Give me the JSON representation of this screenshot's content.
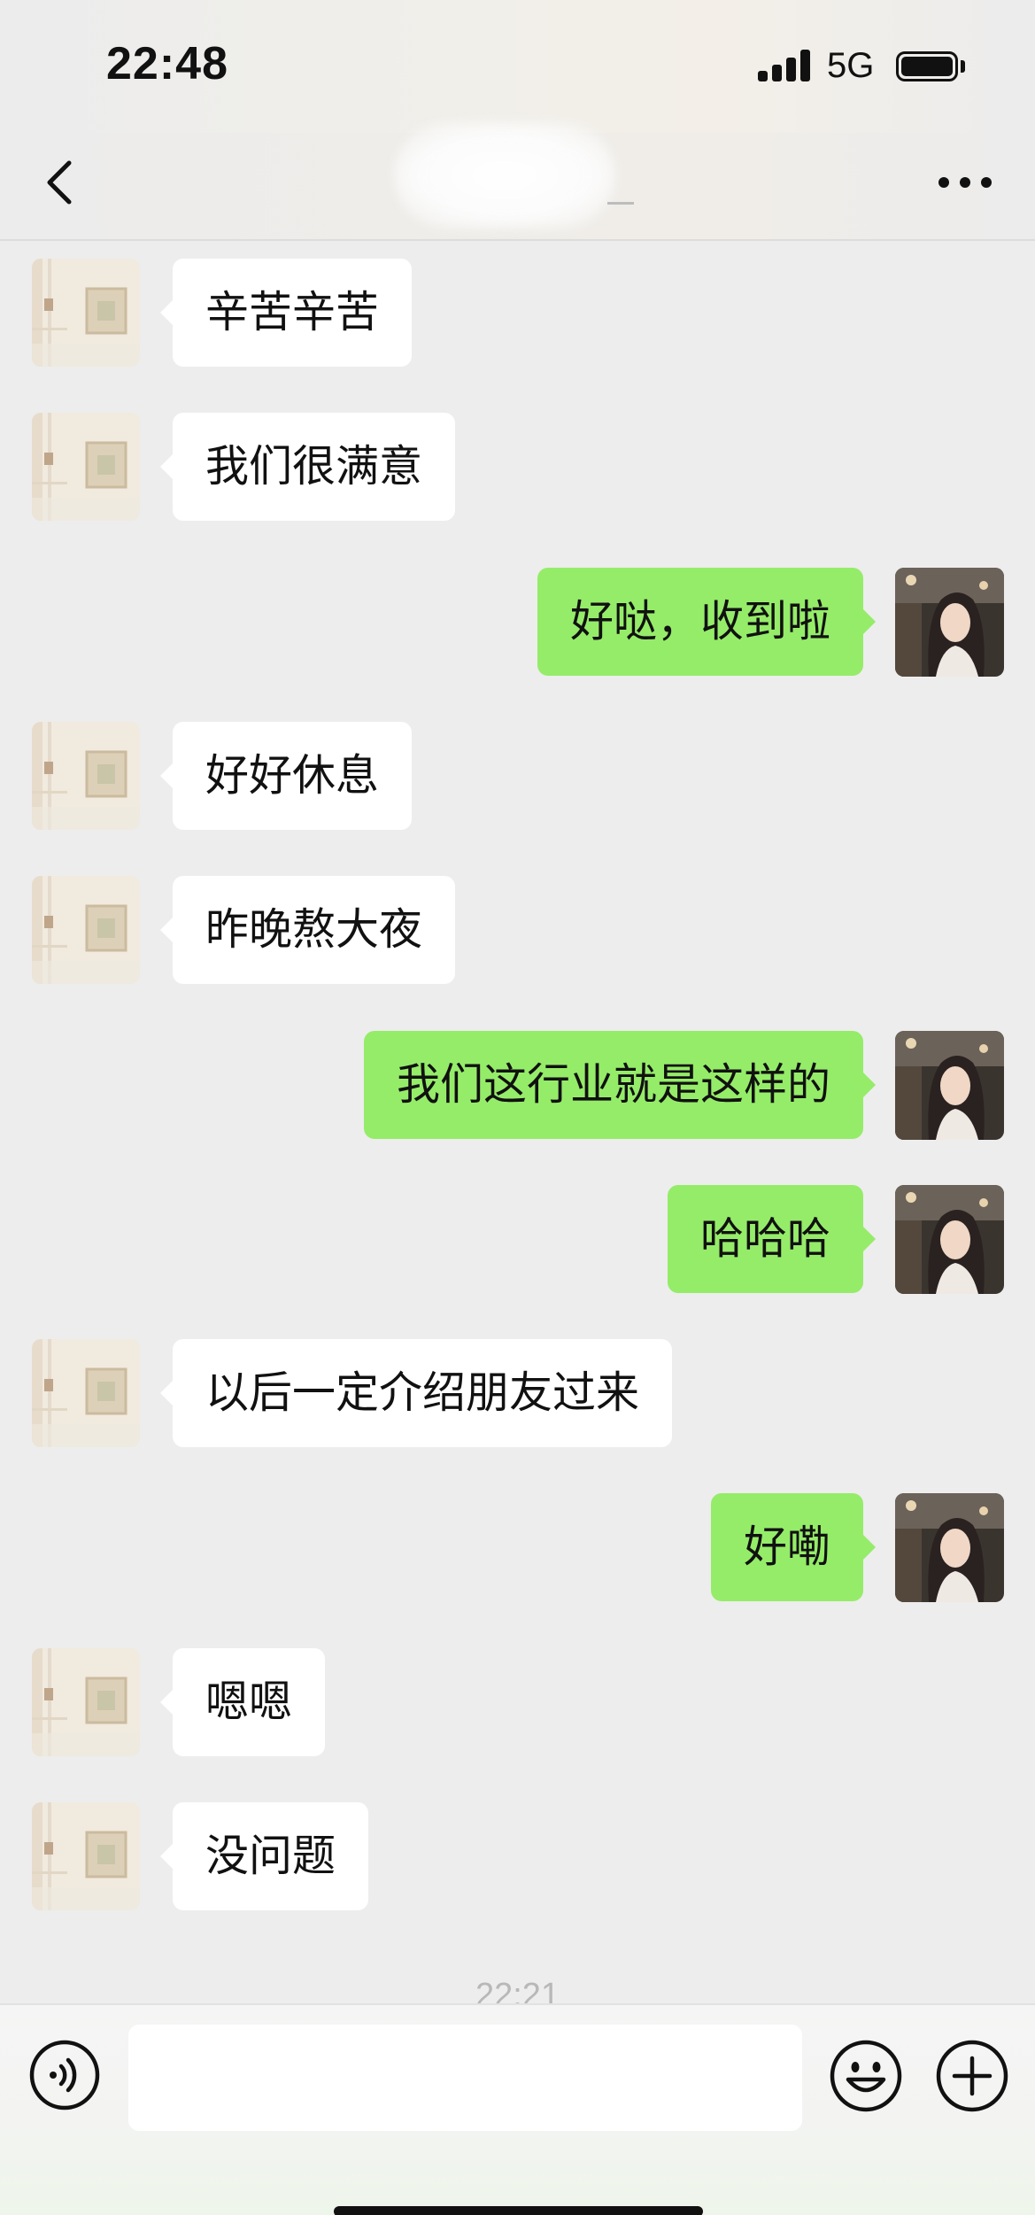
{
  "status_bar": {
    "time": "22:48",
    "network": "5G",
    "signal_bars": 4,
    "battery_level": 1.0
  },
  "nav": {
    "title": "",
    "back_icon": "chevron-left-icon",
    "more_icon": "more-dots-icon"
  },
  "messages": [
    {
      "side": "left",
      "text": "辛苦辛苦"
    },
    {
      "side": "left",
      "text": "我们很满意"
    },
    {
      "side": "right",
      "text": "好哒，收到啦"
    },
    {
      "side": "left",
      "text": "好好休息"
    },
    {
      "side": "left",
      "text": "昨晚熬大夜"
    },
    {
      "side": "right",
      "text": "我们这行业就是这样的"
    },
    {
      "side": "right",
      "text": "哈哈哈"
    },
    {
      "side": "left",
      "text": "以后一定介绍朋友过来"
    },
    {
      "side": "right",
      "text": "好嘞"
    },
    {
      "side": "left",
      "text": "嗯嗯"
    },
    {
      "side": "left",
      "text": "没问题"
    }
  ],
  "timestamp": "22:21",
  "input_bar": {
    "value": "",
    "voice_icon": "voice-icon",
    "emoji_icon": "emoji-icon",
    "plus_icon": "plus-icon"
  },
  "colors": {
    "background": "#ededed",
    "bubble_self": "#95ec69",
    "bubble_other": "#ffffff"
  }
}
